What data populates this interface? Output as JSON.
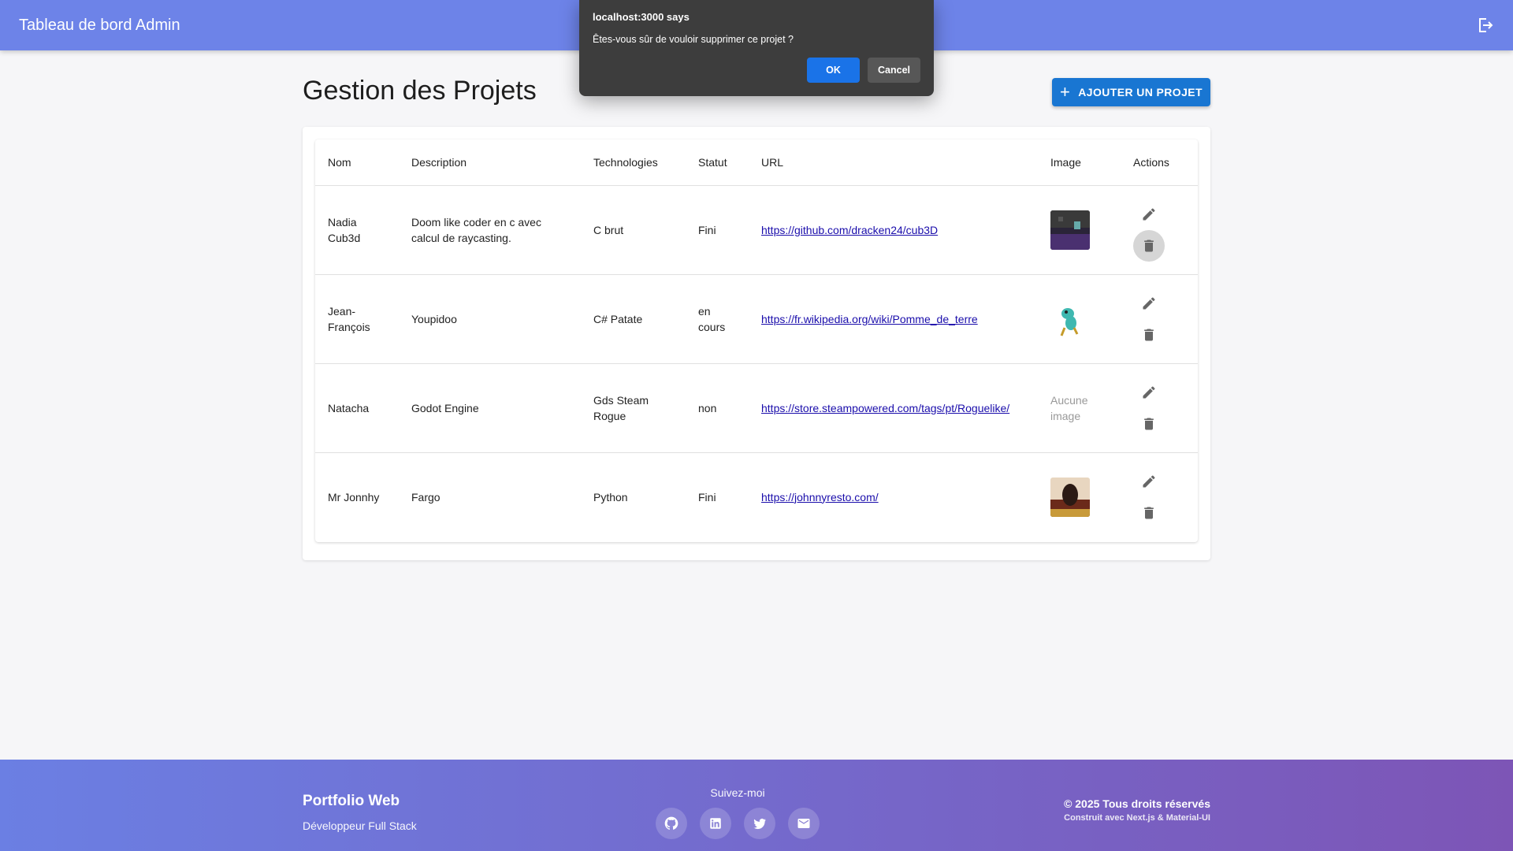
{
  "header": {
    "title": "Tableau de bord Admin",
    "logout_icon": "logout-icon"
  },
  "page": {
    "title": "Gestion des Projets",
    "add_label": "AJOUTER UN PROJET"
  },
  "table": {
    "columns": [
      "Nom",
      "Description",
      "Technologies",
      "Statut",
      "URL",
      "Image",
      "Actions"
    ],
    "rows": [
      {
        "name": "Nadia Cub3d",
        "description": "Doom like coder en c avec calcul de raycasting.",
        "tech": "C brut",
        "status": "Fini",
        "url": "https://github.com/dracken24/cub3D",
        "image": "thumbnail"
      },
      {
        "name": "Jean-François",
        "description": "Youpidoo",
        "tech": "C# Patate",
        "status": "en cours",
        "url": "https://fr.wikipedia.org/wiki/Pomme_de_terre",
        "image": "thumbnail"
      },
      {
        "name": "Natacha",
        "description": "Godot Engine",
        "tech": "Gds Steam Rogue",
        "status": "non",
        "url": "https://store.steampowered.com/tags/pt/Roguelike/",
        "image": "Aucune image"
      },
      {
        "name": "Mr Jonnhy",
        "description": "Fargo",
        "tech": "Python",
        "status": "Fini",
        "url": "https://johnnyresto.com/",
        "image": "thumbnail"
      }
    ]
  },
  "footer": {
    "brand": "Portfolio Web",
    "subtitle": "Développeur Full Stack",
    "follow": "Suivez-moi",
    "socials": [
      "github-icon",
      "linkedin-icon",
      "twitter-icon",
      "email-icon"
    ],
    "copyright": "© 2025 Tous droits réservés",
    "built_with": "Construit avec Next.js & Material-UI"
  },
  "dialog": {
    "origin": "localhost:3000 says",
    "message": "Êtes-vous sûr de vouloir supprimer ce projet ?",
    "ok": "OK",
    "cancel": "Cancel"
  },
  "colors": {
    "appbar": "#6d83e8",
    "primary": "#1976d2",
    "dialog_bg": "#3d3d3d",
    "dialog_ok": "#1a73e8"
  }
}
